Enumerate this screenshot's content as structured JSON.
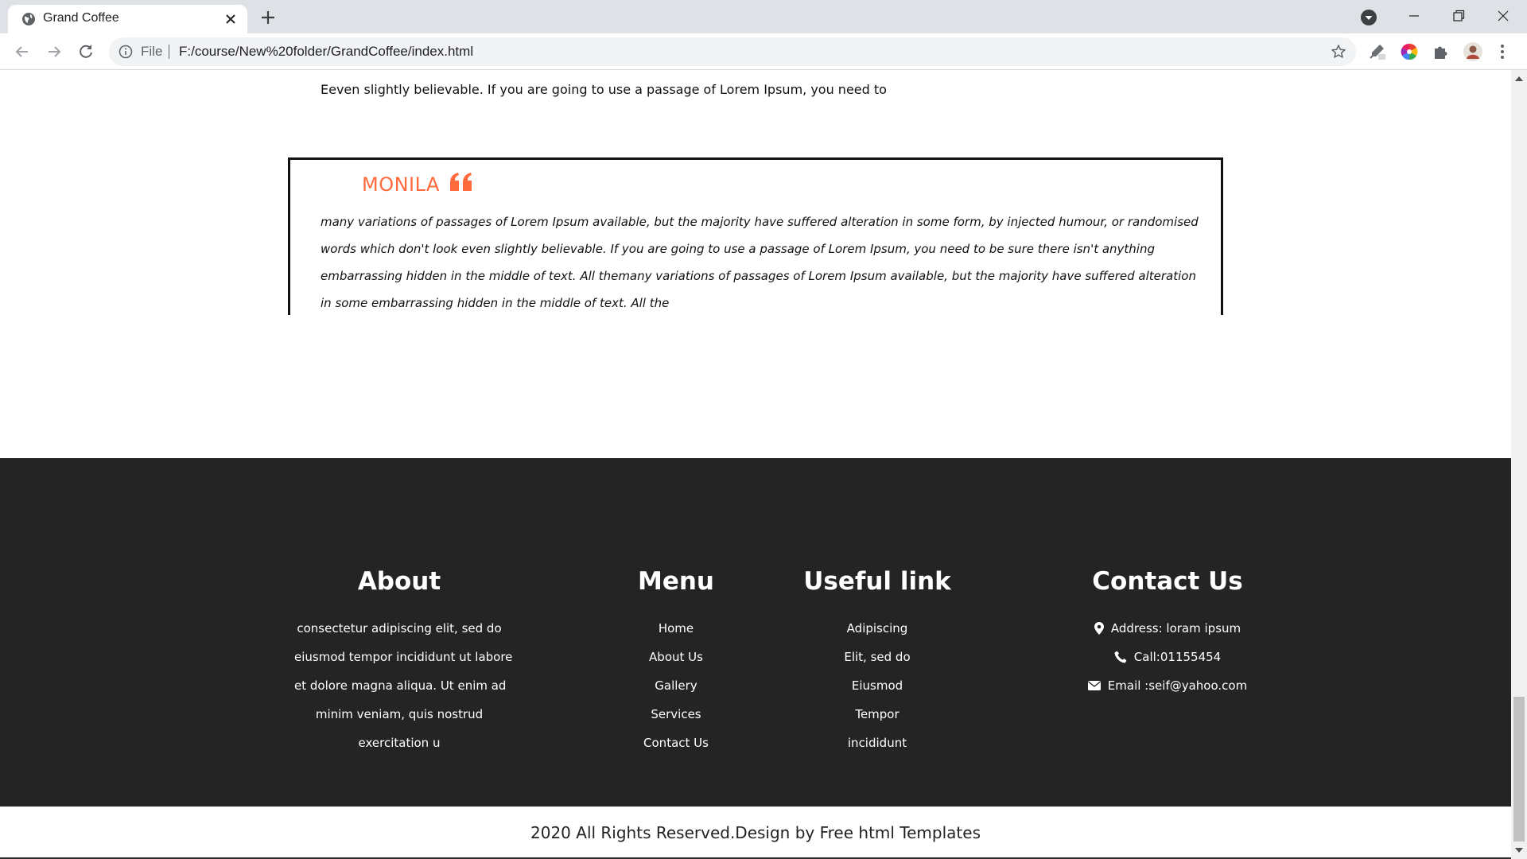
{
  "browser": {
    "tab_title": "Grand Coffee",
    "scheme_label": "File",
    "url": "F:/course/New%20folder/GrandCoffee/index.html",
    "icons": {
      "favicon": "globe-icon",
      "close": "close-icon",
      "new_tab": "plus-icon",
      "profile": "chevron-down-circle-icon",
      "minimize": "minimize-icon",
      "maximize": "restore-icon",
      "window_close": "close-icon",
      "back": "back-arrow-icon",
      "forward": "forward-arrow-icon",
      "reload": "reload-icon",
      "info": "info-icon",
      "bookmark": "star-icon",
      "extensions": [
        "eyedropper-icon",
        "color-wheel-icon",
        "puzzle-icon",
        "avatar-icon",
        "kebab-menu-icon"
      ]
    }
  },
  "page": {
    "intro_text": "Eeven slightly believable. If you are going to use a passage of Lorem Ipsum, you need to",
    "testimonial": {
      "name": "MONILA",
      "text": "many variations of passages of Lorem Ipsum available, but the majority have suffered alteration in some form, by injected humour, or randomised words which don't look even slightly believable. If you are going to use a passage of Lorem Ipsum, you need to be sure there isn't anything embarrassing hidden in the middle of text. All themany variations of passages of Lorem Ipsum available, but the majority have suffered alteration in some embarrassing hidden in the middle of text. All the",
      "accent_color": "#ff6a3d"
    }
  },
  "footer": {
    "background": "#242424",
    "about": {
      "heading": "About",
      "lines": [
        "consectetur adipiscing elit, sed do",
        "eiusmod tempor incididunt ut labore",
        "et dolore magna aliqua. Ut enim ad",
        "minim veniam, quis nostrud",
        "exercitation u"
      ]
    },
    "menu": {
      "heading": "Menu",
      "items": [
        "Home",
        "About Us",
        "Gallery",
        "Services",
        "Contact Us"
      ]
    },
    "useful": {
      "heading": "Useful link",
      "items": [
        "Adipiscing",
        "Elit, sed do",
        "Eiusmod",
        "Tempor",
        "incididunt"
      ]
    },
    "contact": {
      "heading": "Contact Us",
      "address": "Address: loram ipsum",
      "call": "Call:01155454",
      "email": "Email :seif@yahoo.com",
      "icons": [
        "map-pin-icon",
        "phone-icon",
        "envelope-icon"
      ]
    },
    "copyright": "2020 All Rights Reserved.Design by Free html Templates"
  }
}
